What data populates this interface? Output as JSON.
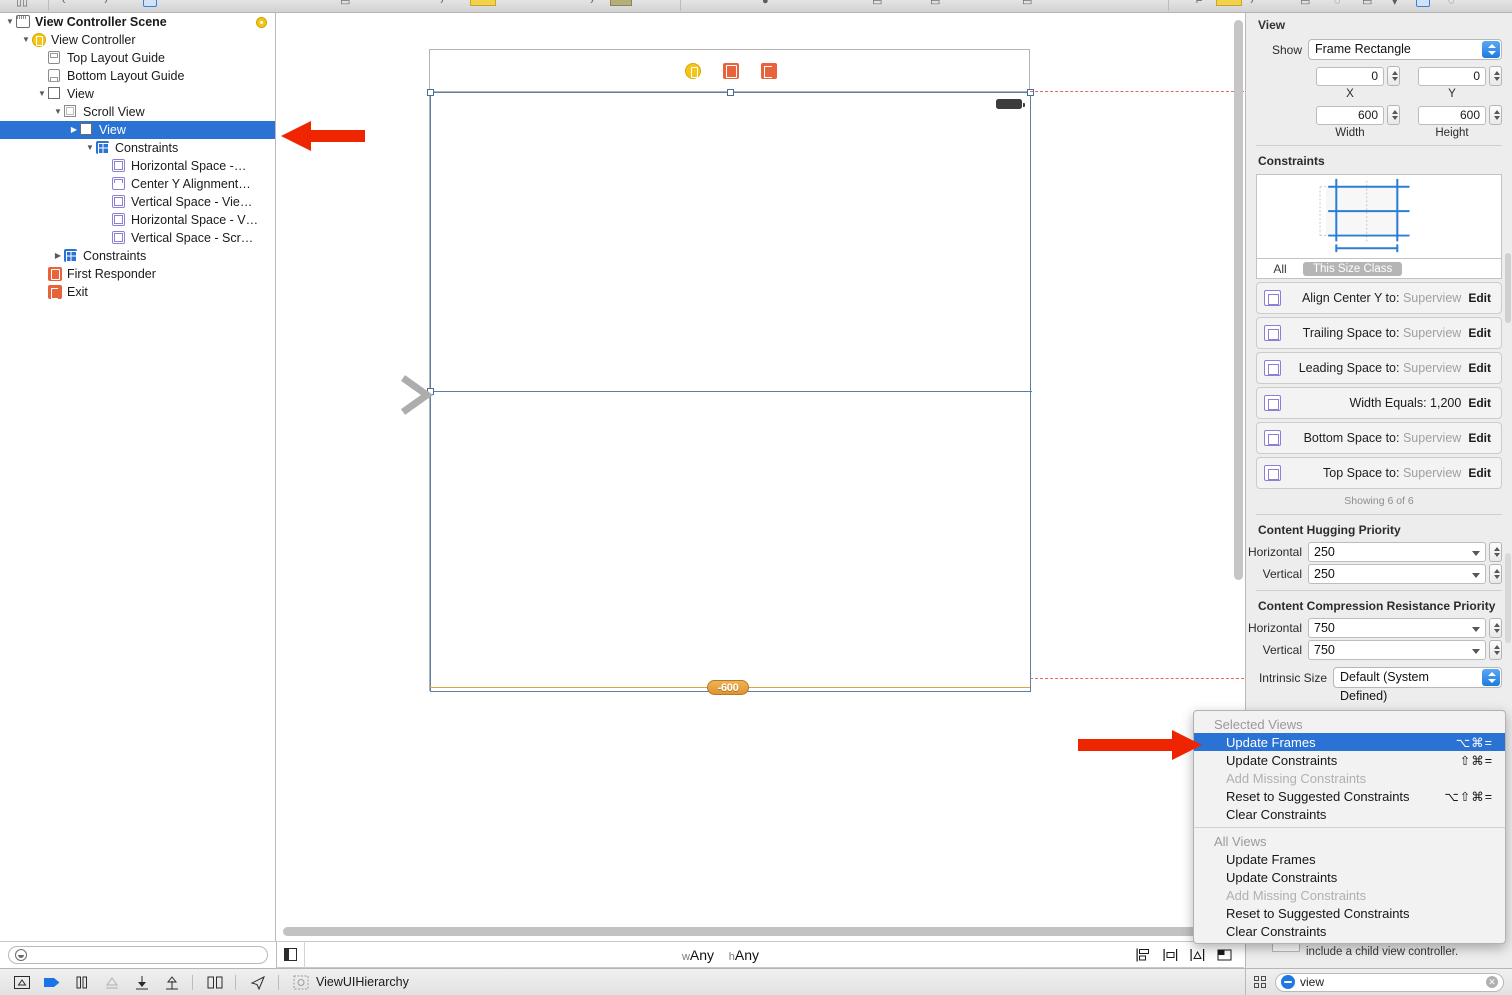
{
  "outline": {
    "items": [
      {
        "label": "View Controller Scene",
        "icon": "scene-icon",
        "indent": 0,
        "disclosure": "down",
        "bold": true,
        "selected": false,
        "badge": "scene-status-badge"
      },
      {
        "label": "View Controller",
        "icon": "view-controller-icon",
        "indent": 1,
        "disclosure": "down",
        "bold": false,
        "selected": false
      },
      {
        "label": "Top Layout Guide",
        "icon": "top-layout-guide-icon",
        "indent": 2,
        "disclosure": "none",
        "bold": false,
        "selected": false
      },
      {
        "label": "Bottom Layout Guide",
        "icon": "bottom-layout-guide-icon",
        "indent": 2,
        "disclosure": "none",
        "bold": false,
        "selected": false
      },
      {
        "label": "View",
        "icon": "view-icon",
        "indent": 2,
        "disclosure": "down",
        "bold": false,
        "selected": false
      },
      {
        "label": "Scroll View",
        "icon": "scroll-view-icon",
        "indent": 3,
        "disclosure": "down",
        "bold": false,
        "selected": false
      },
      {
        "label": "View",
        "icon": "view-icon",
        "indent": 4,
        "disclosure": "right",
        "bold": false,
        "selected": true
      },
      {
        "label": "Constraints",
        "icon": "constraints-folder-icon",
        "indent": 5,
        "disclosure": "down",
        "bold": false,
        "selected": false
      },
      {
        "label": "Horizontal Space -…",
        "icon": "horizontal-space-constraint-icon",
        "indent": 6,
        "disclosure": "none",
        "bold": false,
        "selected": false
      },
      {
        "label": "Center Y Alignment…",
        "icon": "center-y-alignment-constraint-icon",
        "indent": 6,
        "disclosure": "none",
        "bold": false,
        "selected": false
      },
      {
        "label": "Vertical Space - Vie…",
        "icon": "vertical-space-constraint-icon",
        "indent": 6,
        "disclosure": "none",
        "bold": false,
        "selected": false
      },
      {
        "label": "Horizontal Space - V…",
        "icon": "horizontal-space-constraint-icon",
        "indent": 6,
        "disclosure": "none",
        "bold": false,
        "selected": false
      },
      {
        "label": "Vertical Space - Scr…",
        "icon": "vertical-space-constraint-icon",
        "indent": 6,
        "disclosure": "none",
        "bold": false,
        "selected": false
      },
      {
        "label": "Constraints",
        "icon": "constraints-folder-icon",
        "indent": 3,
        "disclosure": "right",
        "bold": false,
        "selected": false
      },
      {
        "label": "First Responder",
        "icon": "first-responder-icon",
        "indent": 2,
        "disclosure": "none",
        "bold": false,
        "selected": false
      },
      {
        "label": "Exit",
        "icon": "exit-icon",
        "indent": 2,
        "disclosure": "none",
        "bold": false,
        "selected": false
      }
    ],
    "filter_placeholder": ""
  },
  "canvas": {
    "width_badge": "-600",
    "scene_icons": [
      "view-controller-icon",
      "first-responder-icon",
      "exit-icon"
    ],
    "bottom_bar": {
      "size_class_w_prefix": "w",
      "size_class_w": "Any",
      "size_class_h_prefix": "h",
      "size_class_h": "Any",
      "icons": [
        "align-icon",
        "pin-icon",
        "resolve-auto-layout-icon",
        "stack-icon"
      ]
    }
  },
  "inspector": {
    "title": "View",
    "show_label": "Show",
    "show_value": "Frame Rectangle",
    "x_value": "0",
    "y_value": "0",
    "width_value": "600",
    "height_value": "600",
    "x_label": "X",
    "y_label": "Y",
    "width_label": "Width",
    "height_label": "Height",
    "constraints_header": "Constraints",
    "size_class_all": "All",
    "size_class_this": "This Size Class",
    "constraints": [
      {
        "name": "Align Center Y to:",
        "value": "Superview",
        "value_dim": true,
        "edit": "Edit",
        "icon": "center-y-alignment-constraint-icon"
      },
      {
        "name": "Trailing Space to:",
        "value": "Superview",
        "value_dim": true,
        "edit": "Edit",
        "icon": "trailing-space-constraint-icon"
      },
      {
        "name": "Leading Space to:",
        "value": "Superview",
        "value_dim": true,
        "edit": "Edit",
        "icon": "leading-space-constraint-icon"
      },
      {
        "name": "Width Equals:",
        "value": "1,200",
        "value_dim": false,
        "edit": "Edit",
        "icon": "width-constraint-icon"
      },
      {
        "name": "Bottom Space to:",
        "value": "Superview",
        "value_dim": true,
        "edit": "Edit",
        "icon": "bottom-space-constraint-icon"
      },
      {
        "name": "Top Space to:",
        "value": "Superview",
        "value_dim": true,
        "edit": "Edit",
        "icon": "top-space-constraint-icon"
      }
    ],
    "showing_text": "Showing 6 of 6",
    "hugging_header": "Content Hugging Priority",
    "hugging_horizontal_label": "Horizontal",
    "hugging_horizontal_value": "250",
    "hugging_vertical_label": "Vertical",
    "hugging_vertical_value": "250",
    "compression_header": "Content Compression Resistance Priority",
    "compression_horizontal_label": "Horizontal",
    "compression_horizontal_value": "750",
    "compression_vertical_label": "Vertical",
    "compression_vertical_value": "750",
    "intrinsic_label": "Intrinsic Size",
    "intrinsic_value": "Default (System Defined)",
    "obscured_text": "include a child view controller.",
    "search_value": "view",
    "accent_color": "#2a72d4"
  },
  "context_menu": {
    "selected_header": "Selected Views",
    "selected_items": [
      {
        "label": "Update Frames",
        "shortcut": "⌥⌘=",
        "disabled": false,
        "active": true
      },
      {
        "label": "Update Constraints",
        "shortcut": "⇧⌘=",
        "disabled": false,
        "active": false
      },
      {
        "label": "Add Missing Constraints",
        "shortcut": "",
        "disabled": true,
        "active": false
      },
      {
        "label": "Reset to Suggested Constraints",
        "shortcut": "⌥⇧⌘=",
        "disabled": false,
        "active": false
      },
      {
        "label": "Clear Constraints",
        "shortcut": "",
        "disabled": false,
        "active": false
      }
    ],
    "all_header": "All Views",
    "all_items": [
      {
        "label": "Update Frames",
        "shortcut": "",
        "disabled": false,
        "active": false
      },
      {
        "label": "Update Constraints",
        "shortcut": "",
        "disabled": false,
        "active": false
      },
      {
        "label": "Add Missing Constraints",
        "shortcut": "",
        "disabled": true,
        "active": false
      },
      {
        "label": "Reset to Suggested Constraints",
        "shortcut": "",
        "disabled": false,
        "active": false
      },
      {
        "label": "Clear Constraints",
        "shortcut": "",
        "disabled": false,
        "active": false
      }
    ]
  },
  "bottom_bar": {
    "breadcrumb": "ViewUIHierarchy",
    "icons": [
      "show-debug-area-icon",
      "step-over-icon",
      "pause-icon",
      "step-into-icon",
      "step-out-icon",
      "step-up-icon",
      "split-icon",
      "location-icon",
      "hierarchy-icon"
    ]
  }
}
